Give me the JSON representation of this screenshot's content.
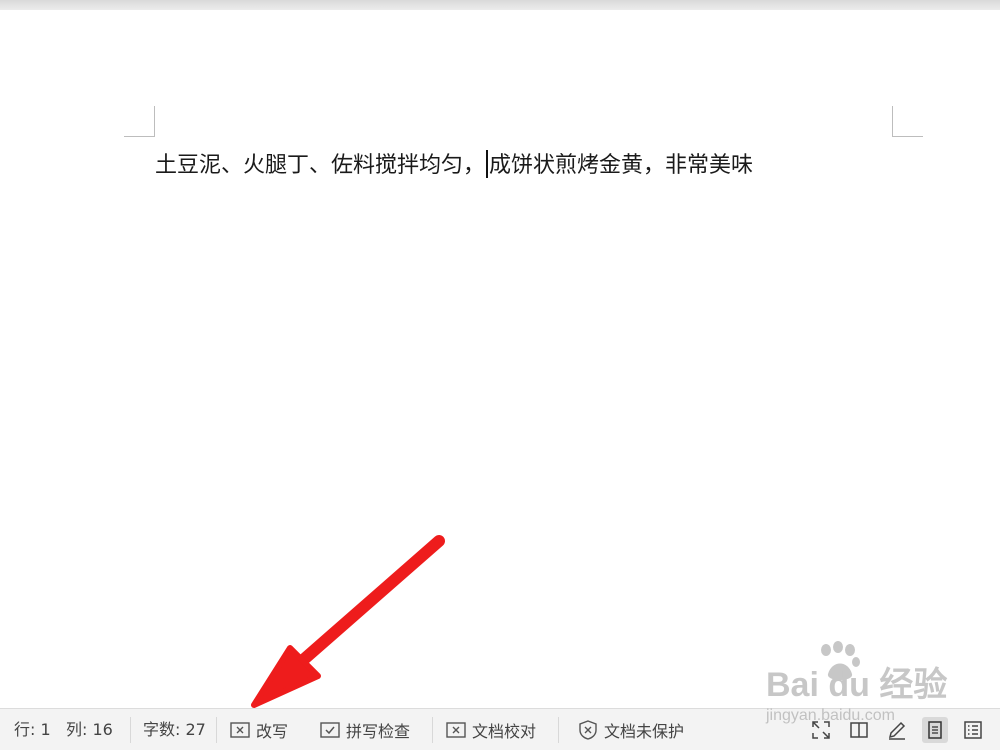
{
  "document": {
    "text_before_cursor": "土豆泥、火腿丁、佐料搅拌均匀，",
    "text_after_cursor": "成饼状煎烤金黄，非常美味"
  },
  "status_bar": {
    "line": "行: 1",
    "column": "列: 16",
    "word_count": "字数: 27",
    "overwrite_label": "改写",
    "spellcheck_label": "拼写检查",
    "proofread_label": "文档校对",
    "protect_label": "文档未保护"
  },
  "watermark": {
    "brand": "Bai du 经验",
    "url": "jingyan.baidu.com"
  },
  "colors": {
    "arrow": "#ee1c1c",
    "status_bg": "#f3f3f3",
    "text": "#1a1a1a"
  }
}
